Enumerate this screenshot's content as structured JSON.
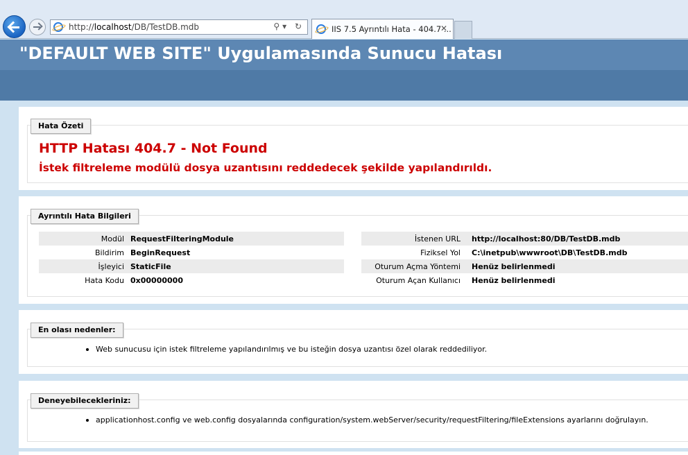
{
  "browser": {
    "address_prefix": "http://",
    "address_host": "localhost",
    "address_path": "/DB/TestDB.mdb",
    "address_tools": "⚲▾ ↻",
    "tab_title": "IIS 7.5 Ayrıntılı Hata - 404.7 ...",
    "tab_close": "✕"
  },
  "page": {
    "title": "\"DEFAULT WEB SITE\" Uygulamasında Sunucu Hatası"
  },
  "summary": {
    "legend": "Hata Özeti",
    "error_title": "HTTP Hatası 404.7 - Not Found",
    "error_message": "İstek filtreleme modülü dosya uzantısını reddedecek şekilde yapılandırıldı."
  },
  "details": {
    "legend": "Ayrıntılı Hata Bilgileri",
    "left": [
      {
        "key": "Modül",
        "value": "RequestFilteringModule"
      },
      {
        "key": "Bildirim",
        "value": "BeginRequest"
      },
      {
        "key": "İşleyici",
        "value": "StaticFile"
      },
      {
        "key": "Hata Kodu",
        "value": "0x00000000"
      }
    ],
    "right": [
      {
        "key": "İstenen URL",
        "value": "http://localhost:80/DB/TestDB.mdb"
      },
      {
        "key": "Fiziksel Yol",
        "value": "C:\\inetpub\\wwwroot\\DB\\TestDB.mdb"
      },
      {
        "key": "Oturum Açma Yöntemi",
        "value": "Henüz belirlenmedi"
      },
      {
        "key": "Oturum Açan Kullanıcı",
        "value": "Henüz belirlenmedi"
      }
    ]
  },
  "causes": {
    "legend": "En olası nedenler:",
    "items": [
      "Web sunucusu için istek filtreleme yapılandırılmış ve bu isteğin dosya uzantısı özel olarak reddediliyor."
    ]
  },
  "tries": {
    "legend": "Deneyebilecekleriniz:",
    "items": [
      "applicationhost.config ve web.config dosyalarında configuration/system.webServer/security/requestFiltering/fileExtensions ayarlarını doğrulayın."
    ]
  }
}
